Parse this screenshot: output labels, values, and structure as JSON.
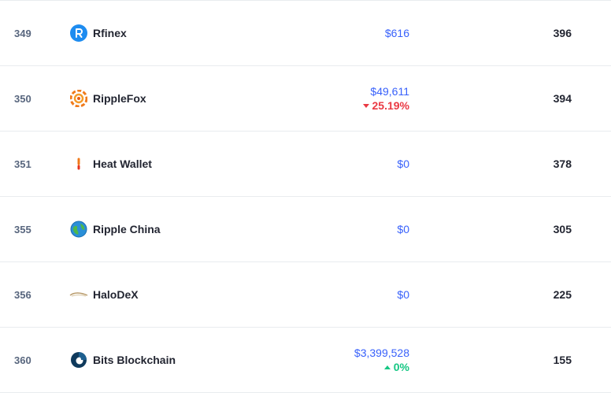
{
  "rows": [
    {
      "rank": "349",
      "name": "Rfinex",
      "logo": "rfinex-logo",
      "volume": "$616",
      "change": "",
      "change_dir": "",
      "score": "396"
    },
    {
      "rank": "350",
      "name": "RippleFox",
      "logo": "ripplefox-logo",
      "volume": "$49,611",
      "change": "25.19%",
      "change_dir": "down",
      "score": "394"
    },
    {
      "rank": "351",
      "name": "Heat Wallet",
      "logo": "heat-wallet-logo",
      "volume": "$0",
      "change": "",
      "change_dir": "",
      "score": "378"
    },
    {
      "rank": "355",
      "name": "Ripple China",
      "logo": "ripple-china-logo",
      "volume": "$0",
      "change": "",
      "change_dir": "",
      "score": "305"
    },
    {
      "rank": "356",
      "name": "HaloDeX",
      "logo": "halodex-logo",
      "volume": "$0",
      "change": "",
      "change_dir": "",
      "score": "225"
    },
    {
      "rank": "360",
      "name": "Bits Blockchain",
      "logo": "bits-blockchain-logo",
      "volume": "$3,399,528",
      "change": "0%",
      "change_dir": "up",
      "score": "155"
    }
  ],
  "colors": {
    "link_blue": "#3861fb",
    "down_red": "#ea3943",
    "up_green": "#16c784",
    "text_dark": "#222531",
    "text_muted": "#58667e"
  }
}
